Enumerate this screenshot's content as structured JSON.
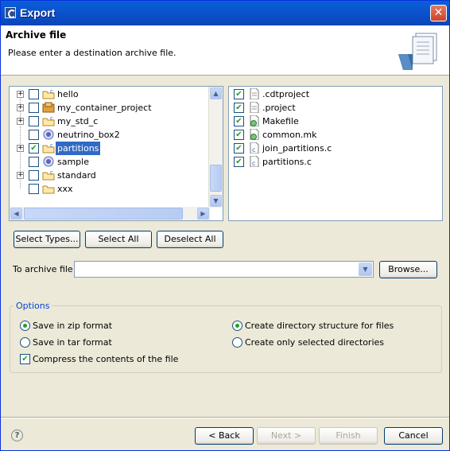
{
  "window": {
    "title": "Export"
  },
  "header": {
    "title": "Archive file",
    "description": "Please enter a destination archive file."
  },
  "tree": {
    "items": [
      {
        "label": "hello",
        "icon": "project-folder-icon",
        "checked": false,
        "expandable": true
      },
      {
        "label": "my_container_project",
        "icon": "container-project-icon",
        "checked": false,
        "expandable": true
      },
      {
        "label": "my_std_c",
        "icon": "project-folder-icon",
        "checked": false,
        "expandable": true
      },
      {
        "label": "neutrino_box2",
        "icon": "target-icon",
        "checked": false,
        "expandable": false
      },
      {
        "label": "partitions",
        "icon": "project-folder-icon",
        "checked": true,
        "expandable": true
      },
      {
        "label": "sample",
        "icon": "target-icon",
        "checked": false,
        "expandable": false
      },
      {
        "label": "standard",
        "icon": "project-folder-icon",
        "checked": false,
        "expandable": true
      },
      {
        "label": "xxx",
        "icon": "folder-icon",
        "checked": false,
        "expandable": false
      }
    ]
  },
  "files": {
    "items": [
      {
        "label": ".cdtproject",
        "icon": "text-file-icon",
        "checked": true
      },
      {
        "label": ".project",
        "icon": "text-file-icon",
        "checked": true
      },
      {
        "label": "Makefile",
        "icon": "makefile-icon",
        "checked": true
      },
      {
        "label": "common.mk",
        "icon": "makefile-icon",
        "checked": true
      },
      {
        "label": "join_partitions.c",
        "icon": "c-file-icon",
        "checked": true
      },
      {
        "label": "partitions.c",
        "icon": "c-file-icon",
        "checked": true
      }
    ]
  },
  "buttons": {
    "select_types": "Select Types...",
    "select_all": "Select All",
    "deselect_all": "Deselect All",
    "browse": "Browse..."
  },
  "archive": {
    "label": "To archive file:",
    "value": ""
  },
  "options": {
    "legend": "Options",
    "zip": "Save in zip format",
    "tar": "Save in tar format",
    "compress": "Compress the contents of the file",
    "dir_structure": "Create directory structure for files",
    "selected_dirs": "Create only selected directories"
  },
  "footer": {
    "back": "< Back",
    "next": "Next >",
    "finish": "Finish",
    "cancel": "Cancel"
  },
  "colors": {
    "accent": "#316ac5",
    "check": "#21a121",
    "title_bar": "#0a5fd8",
    "legend": "#0046d5"
  }
}
